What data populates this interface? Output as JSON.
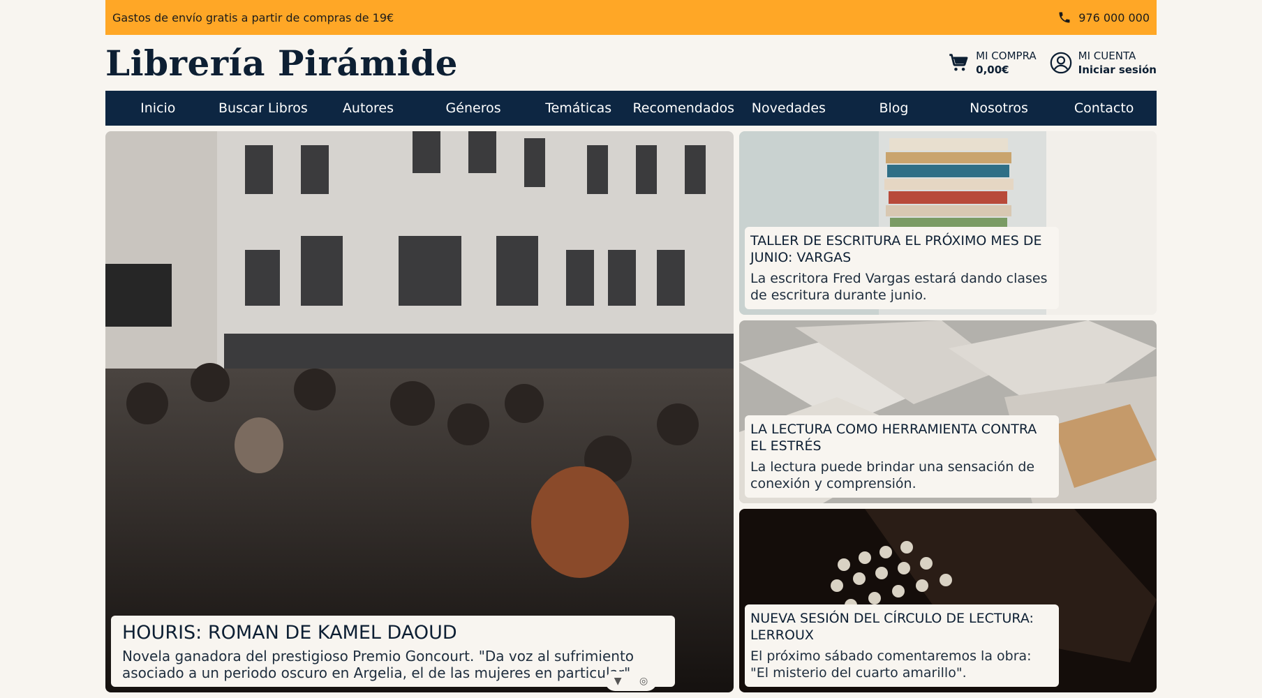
{
  "topbar": {
    "promo": "Gastos de envío gratis a partir de compras de 19€",
    "phone": "976 000 000"
  },
  "header": {
    "logo": "Librería Pirámide",
    "cart": {
      "label": "MI COMPRA",
      "value": "0,00€"
    },
    "account": {
      "label": "MI CUENTA",
      "value": "Iniciar sesión"
    }
  },
  "nav": [
    "Inicio",
    "Buscar Libros",
    "Autores",
    "Géneros",
    "Temáticas",
    "Recomendados",
    "Novedades",
    "Blog",
    "Nosotros",
    "Contacto"
  ],
  "featured": {
    "title": "HOURIS: ROMAN DE KAMEL DAOUD",
    "description": "Novela ganadora del prestigioso Premio Goncourt. \"Da voz al sufrimiento asociado a un periodo oscuro en Argelia, el de las mujeres en particular\"."
  },
  "side_articles": [
    {
      "title": "TALLER DE ESCRITURA EL PRÓXIMO MES DE JUNIO: VARGAS",
      "description": "La escritora Fred Vargas estará dando clases de escritura durante junio."
    },
    {
      "title": "LA LECTURA COMO HERRAMIENTA CONTRA EL ESTRÉS",
      "description": "La lectura puede brindar una sensación de conexión y comprensión."
    },
    {
      "title": "NUEVA SESIÓN DEL CÍRCULO DE LECTURA: LERROUX",
      "description": "El próximo sábado comentaremos la obra: \"El misterio del cuarto amarillo\"."
    }
  ],
  "carousel_controls": {
    "left_icon": "▼",
    "right_icon": "◎"
  },
  "colors": {
    "topbar": "#ffa726",
    "nav": "#0d2642",
    "background": "#f8f5f0",
    "text": "#0d1f33"
  }
}
